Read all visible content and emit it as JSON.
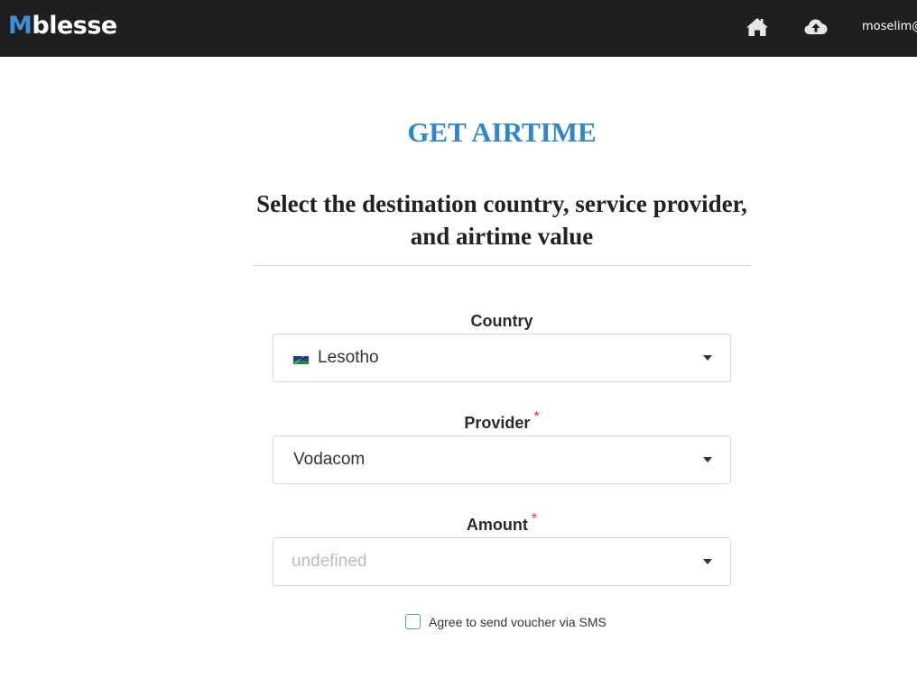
{
  "navbar": {
    "logo_m": "M",
    "logo_rest": "blesse",
    "user_label": "moselim@",
    "home_icon": "home-icon",
    "upload_icon": "cloud-upload-icon"
  },
  "page": {
    "title": "GET AIRTIME",
    "subtitle": "Select the destination country, service provider, and airtime value"
  },
  "form": {
    "country": {
      "label": "Country",
      "value": "Lesotho",
      "flag_icon": "lesotho-flag-icon"
    },
    "provider": {
      "label": "Provider",
      "required_mark": "*",
      "value": "Vodacom"
    },
    "amount": {
      "label": "Amount",
      "required_mark": "*",
      "placeholder": "undefined"
    },
    "sms_checkbox": {
      "label": "Agree to send voucher via SMS",
      "checked": false
    }
  },
  "colors": {
    "navbar_bg": "#1f1f20",
    "accent": "#2f86cc",
    "required": "#e03030"
  }
}
